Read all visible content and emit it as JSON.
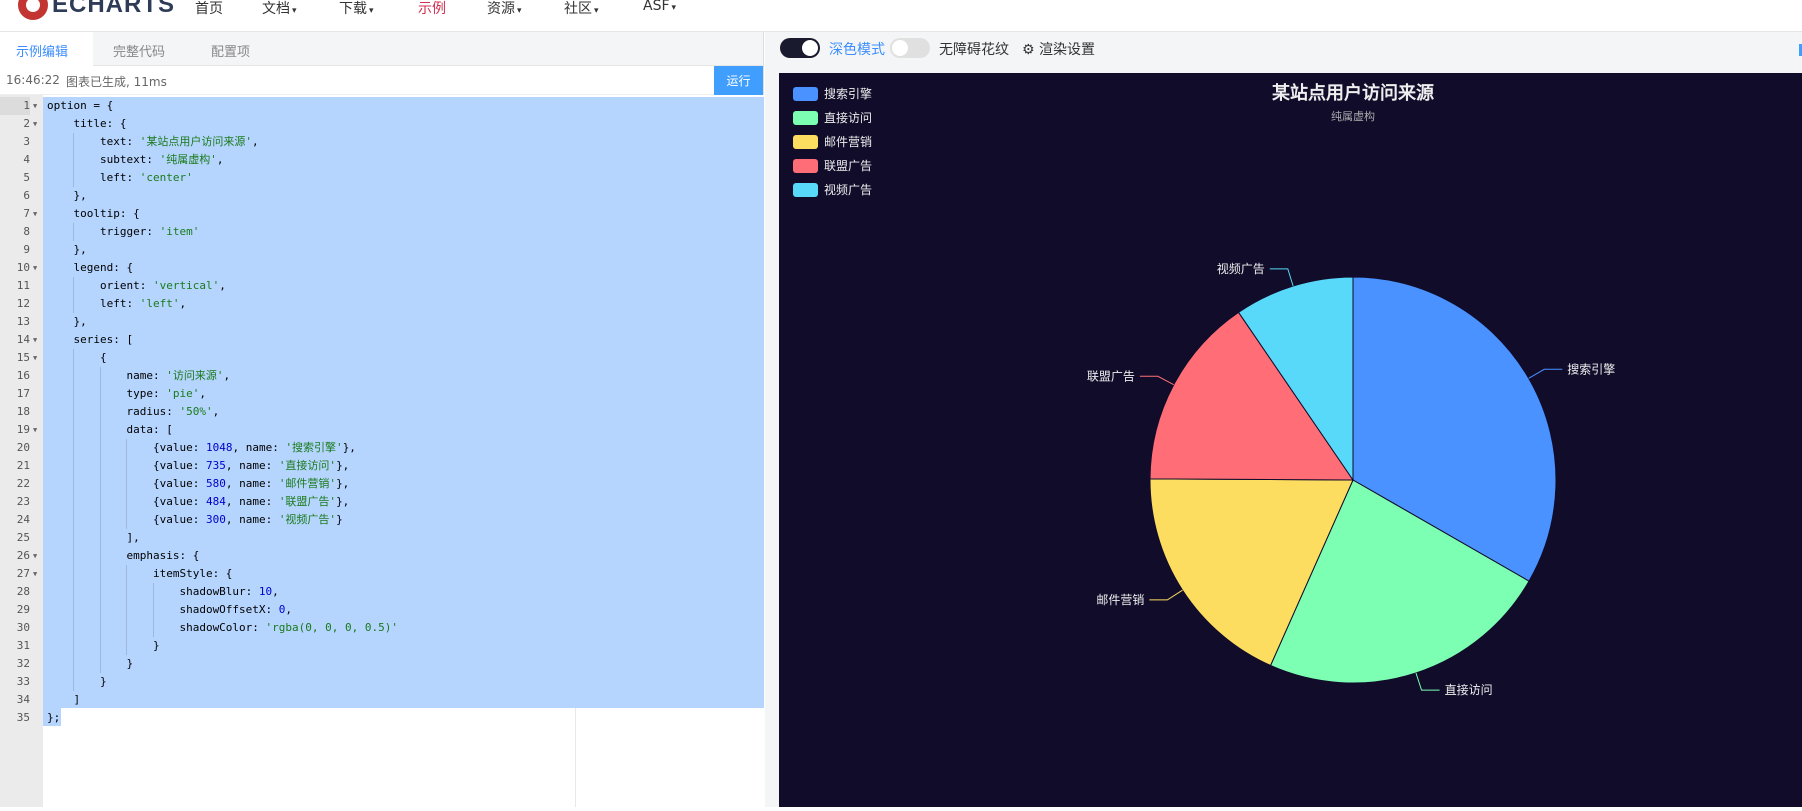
{
  "nav": {
    "logo_text": "ECHARTS",
    "items": [
      {
        "label": "首页",
        "caret": false
      },
      {
        "label": "文档",
        "caret": true
      },
      {
        "label": "下载",
        "caret": true
      },
      {
        "label": "示例",
        "caret": false,
        "active": true
      },
      {
        "label": "资源",
        "caret": true
      },
      {
        "label": "社区",
        "caret": true
      },
      {
        "label": "ASF",
        "caret": true
      }
    ]
  },
  "editor_tabs": [
    "示例编辑",
    "完整代码",
    "配置项"
  ],
  "status": {
    "time": "16:46:22",
    "message": "图表已生成, 11ms",
    "run_label": "运行"
  },
  "code_lines": [
    "option = {",
    "    title: {",
    "        text: '某站点用户访问来源',",
    "        subtext: '纯属虚构',",
    "        left: 'center'",
    "    },",
    "    tooltip: {",
    "        trigger: 'item'",
    "    },",
    "    legend: {",
    "        orient: 'vertical',",
    "        left: 'left',",
    "    },",
    "    series: [",
    "        {",
    "            name: '访问来源',",
    "            type: 'pie',",
    "            radius: '50%',",
    "            data: [",
    "                {value: 1048, name: '搜索引擎'},",
    "                {value: 735, name: '直接访问'},",
    "                {value: 580, name: '邮件营销'},",
    "                {value: 484, name: '联盟广告'},",
    "                {value: 300, name: '视频广告'}",
    "            ],",
    "            emphasis: {",
    "                itemStyle: {",
    "                    shadowBlur: 10,",
    "                    shadowOffsetX: 0,",
    "                    shadowColor: 'rgba(0, 0, 0, 0.5)'",
    "                }",
    "            }",
    "        }",
    "    ]",
    "};"
  ],
  "fold_lines": [
    1,
    2,
    7,
    10,
    14,
    15,
    19,
    26,
    27
  ],
  "toolbar": {
    "dark_mode_label": "深色模式",
    "aria_label": "无障碍花纹",
    "render_settings_label": "渲染设置"
  },
  "colors": {
    "accent": "#3c8eff",
    "chart_bg": "#100c2a",
    "run_button": "#409eff"
  },
  "chart_data": {
    "type": "pie",
    "title": "某站点用户访问来源",
    "subtitle": "纯属虚构",
    "series_name": "访问来源",
    "radius": "50%",
    "legend": {
      "orient": "vertical",
      "placement": "top-left"
    },
    "data": [
      {
        "name": "搜索引擎",
        "value": 1048,
        "color": "#4992ff"
      },
      {
        "name": "直接访问",
        "value": 735,
        "color": "#7cffb2"
      },
      {
        "name": "邮件营销",
        "value": 580,
        "color": "#fddd60"
      },
      {
        "name": "联盟广告",
        "value": 484,
        "color": "#ff6e76"
      },
      {
        "name": "视频广告",
        "value": 300,
        "color": "#58d9f9"
      }
    ]
  }
}
